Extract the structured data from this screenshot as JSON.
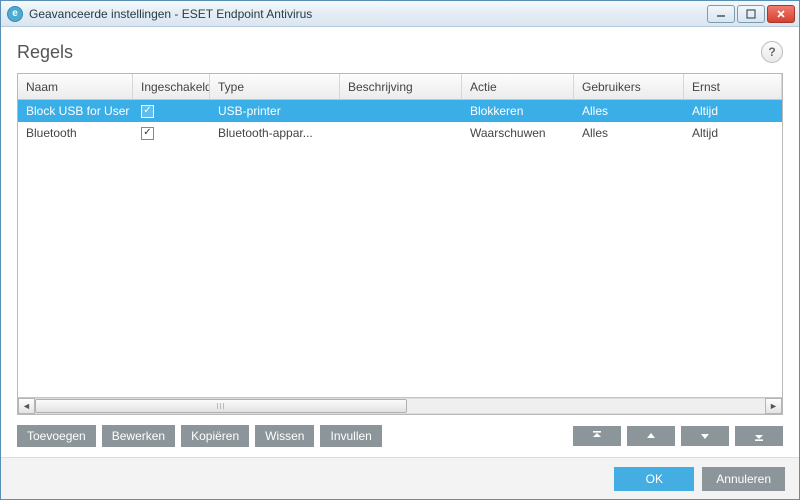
{
  "window": {
    "title": "Geavanceerde instellingen - ESET Endpoint Antivirus",
    "app_icon_letter": "e"
  },
  "section": {
    "title": "Regels",
    "help_label": "?"
  },
  "table": {
    "headers": {
      "naam": "Naam",
      "ingeschakeld": "Ingeschakeld",
      "type": "Type",
      "beschrijving": "Beschrijving",
      "actie": "Actie",
      "gebruikers": "Gebruikers",
      "ernst": "Ernst"
    },
    "rows": [
      {
        "naam": "Block USB for User",
        "ingeschakeld": true,
        "type": "USB-printer",
        "beschrijving": "",
        "actie": "Blokkeren",
        "gebruikers": "Alles",
        "ernst": "Altijd",
        "selected": true
      },
      {
        "naam": "Bluetooth",
        "ingeschakeld": true,
        "type": "Bluetooth-appar...",
        "beschrijving": "",
        "actie": "Waarschuwen",
        "gebruikers": "Alles",
        "ernst": "Altijd",
        "selected": false
      }
    ]
  },
  "toolbar": {
    "toevoegen": "Toevoegen",
    "bewerken": "Bewerken",
    "kopieren": "Kopiëren",
    "wissen": "Wissen",
    "invullen": "Invullen"
  },
  "footer": {
    "ok": "OK",
    "cancel": "Annuleren"
  },
  "checkmark": "✓"
}
